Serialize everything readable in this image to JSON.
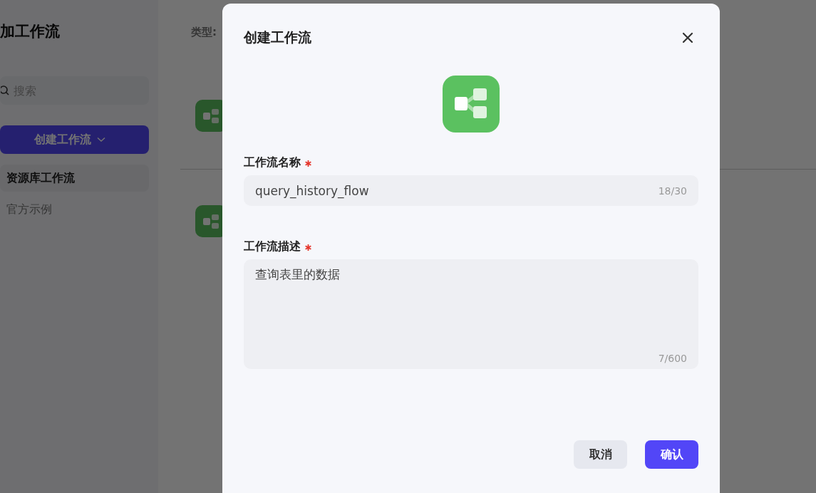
{
  "sidebar": {
    "title": "加工作流",
    "search": {
      "placeholder": "搜索"
    },
    "create_button": {
      "label": "创建工作流"
    },
    "items": [
      {
        "label": "资源库工作流",
        "selected": true
      },
      {
        "label": "官方示例",
        "selected": false
      }
    ]
  },
  "main": {
    "filter_label": "类型:"
  },
  "dialog": {
    "title": "创建工作流",
    "fields": [
      {
        "kind": "input",
        "label": "工作流名称",
        "required": true,
        "value": "query_history_flow",
        "counter": "18/30"
      },
      {
        "kind": "textarea",
        "label": "工作流描述",
        "required": true,
        "value": "查询表里的数据",
        "counter": "7/600"
      }
    ],
    "buttons": [
      {
        "label": "取消",
        "primary": false
      },
      {
        "label": "确认",
        "primary": true
      }
    ]
  }
}
